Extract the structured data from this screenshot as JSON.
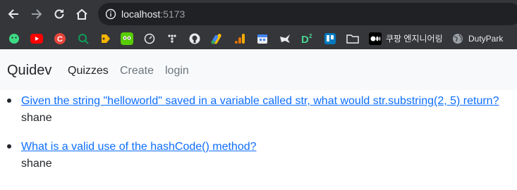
{
  "browser": {
    "url_host": "localhost",
    "url_port": ":5173",
    "bookmarks": [
      {
        "icon": "green-app-icon",
        "color": "#3ddc84"
      },
      {
        "icon": "youtube-icon",
        "color": "#ff0000"
      },
      {
        "icon": "c-logo-icon",
        "color": "#e8453c"
      },
      {
        "icon": "green-search-icon",
        "color": "#0f9d58"
      },
      {
        "icon": "tag-icon",
        "color": "#f5b400"
      },
      {
        "icon": "duolingo-icon",
        "color": "#58cc02"
      },
      {
        "icon": "speedometer-icon",
        "color": "#e8eaed"
      },
      {
        "icon": "tistory-icon",
        "color": "#e8eaed"
      },
      {
        "icon": "github-icon",
        "color": "#e8eaed"
      },
      {
        "icon": "google-ads-icon",
        "color": "#fbbc04"
      },
      {
        "icon": "analytics-icon",
        "color": "#f9ab00"
      },
      {
        "icon": "calendar-icon",
        "color": "#4285f4"
      },
      {
        "icon": "bird-icon",
        "color": "#e8eaed"
      },
      {
        "icon": "d2-icon",
        "color": "#4ad28f"
      },
      {
        "icon": "trello-icon",
        "color": "#0079bf"
      },
      {
        "icon": "folder-icon",
        "color": "#e8eaed"
      }
    ],
    "bookmark_coupang": "쿠팡 엔지니어링",
    "bookmark_dutypark": "DutyPark"
  },
  "navbar": {
    "brand": "Quidev",
    "links": [
      "Quizzes",
      "Create",
      "login"
    ]
  },
  "quizzes": [
    {
      "title": "Given the string \"helloworld\" saved in a variable called str, what would str.substring(2, 5) return?",
      "author": "shane"
    },
    {
      "title": "What is a valid use of the hashCode() method?",
      "author": "shane"
    }
  ],
  "colors": {
    "link": "#0d6efd",
    "navbar_bg": "#f8f9fa",
    "chrome_bg": "#35363a",
    "omnibox_bg": "#202124"
  }
}
